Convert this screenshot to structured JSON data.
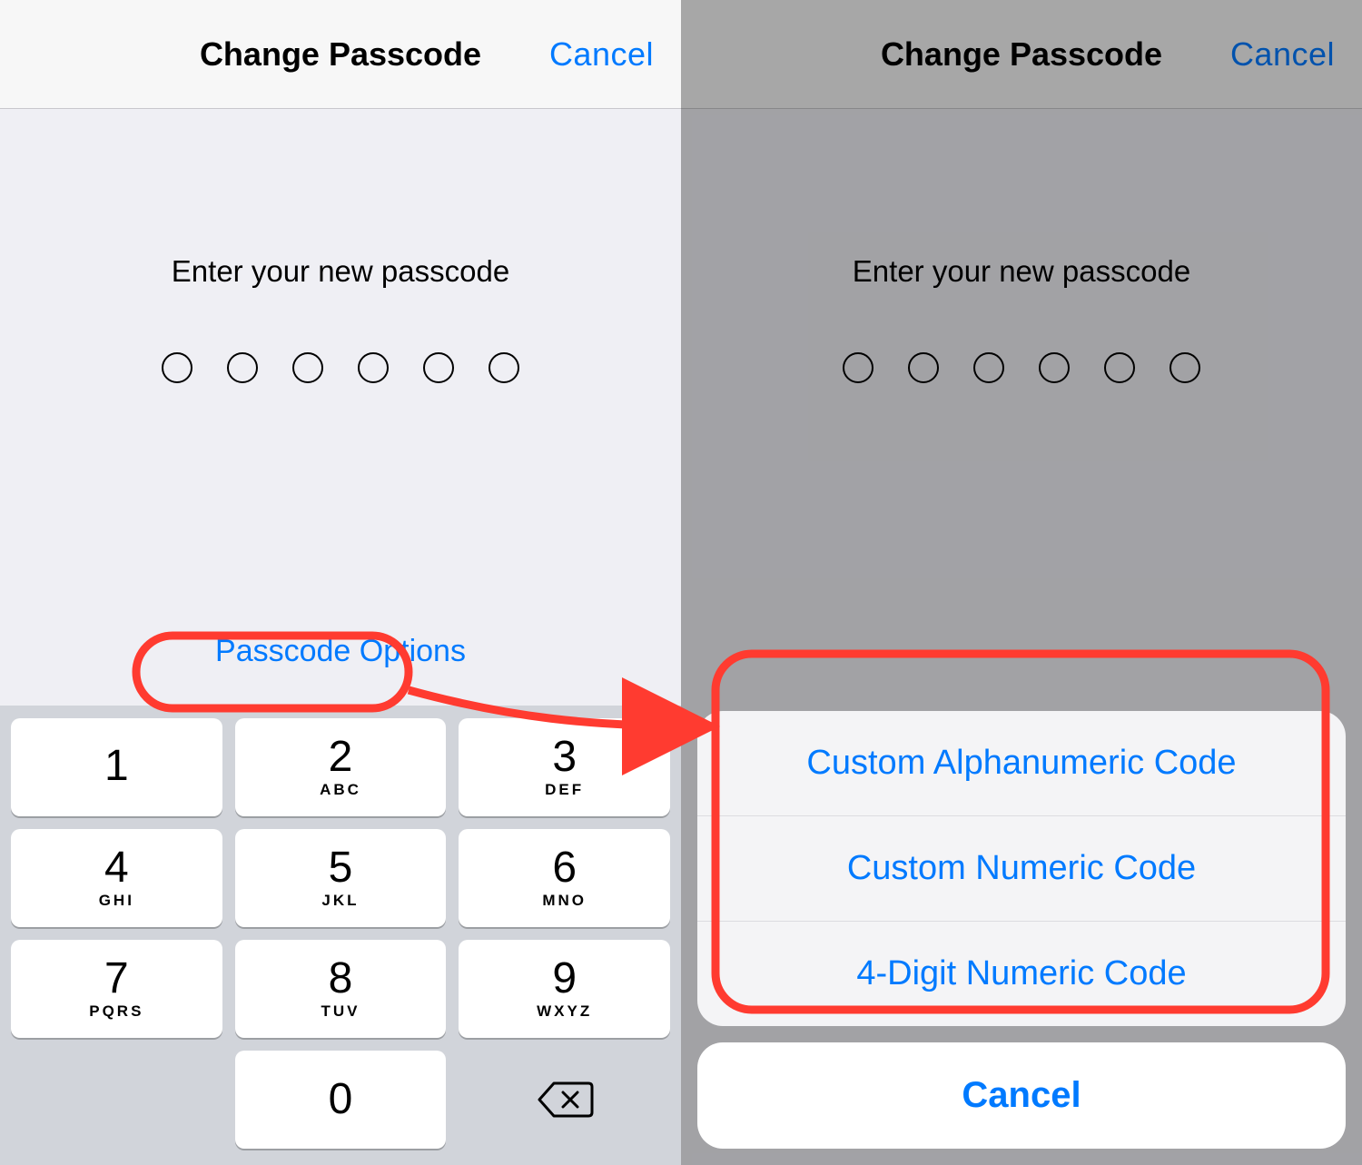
{
  "nav": {
    "title": "Change Passcode",
    "cancel": "Cancel"
  },
  "body": {
    "prompt": "Enter your new passcode",
    "passcode_length": 6,
    "options_link": "Passcode Options"
  },
  "keypad": {
    "keys": [
      {
        "digit": "1",
        "letters": ""
      },
      {
        "digit": "2",
        "letters": "ABC"
      },
      {
        "digit": "3",
        "letters": "DEF"
      },
      {
        "digit": "4",
        "letters": "GHI"
      },
      {
        "digit": "5",
        "letters": "JKL"
      },
      {
        "digit": "6",
        "letters": "MNO"
      },
      {
        "digit": "7",
        "letters": "PQRS"
      },
      {
        "digit": "8",
        "letters": "TUV"
      },
      {
        "digit": "9",
        "letters": "WXYZ"
      }
    ],
    "zero": "0"
  },
  "sheet": {
    "items": [
      "Custom Alphanumeric Code",
      "Custom Numeric Code",
      "4-Digit Numeric Code"
    ],
    "cancel": "Cancel"
  },
  "annotation": {
    "color": "#ff3b30"
  }
}
